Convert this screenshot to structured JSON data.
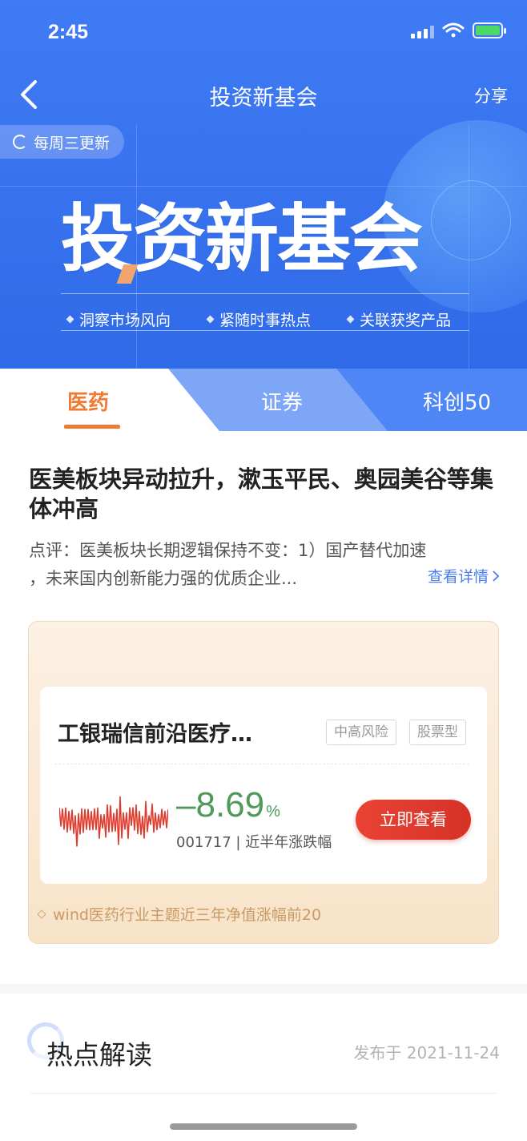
{
  "status_bar": {
    "time": "2:45"
  },
  "nav": {
    "title": "投资新基会",
    "share": "分享",
    "back_icon": "chevron-left-icon"
  },
  "banner": {
    "update_pill": "每周三更新",
    "title": "投资新基会",
    "tags": [
      "洞察市场风向",
      "紧随时事热点",
      "关联获奖产品"
    ]
  },
  "tabs": [
    {
      "label": "医药",
      "active": true
    },
    {
      "label": "证券",
      "active": false
    },
    {
      "label": "科创50",
      "active": false
    }
  ],
  "article": {
    "title": "医美板块异动拉升，漱玉平民、奥园美谷等集体冲高",
    "desc_line1": "点评：医美板块长期逻辑保持不变：1）国产替代加速",
    "desc_line2": "，未来国内创新能力强的优质企业...",
    "detail_link": "查看详情"
  },
  "fund_card": {
    "name": "工银瑞信前沿医疗…",
    "badges": [
      "中高风险",
      "股票型"
    ],
    "change_value": "–8.69",
    "change_unit": "%",
    "meta": "001717 | 近半年涨跌幅",
    "cta": "立即查看",
    "note": "wind医药行业主题近三年净值涨幅前20",
    "colors": {
      "negative": "#4f9a5a",
      "sparkline": "#e23b2e",
      "cta": "#e23b2e"
    }
  },
  "section": {
    "title": "热点解读",
    "date": "发布于 2021-11-24"
  },
  "colors": {
    "primary": "#3f7bf4",
    "accent": "#ee7a34"
  }
}
